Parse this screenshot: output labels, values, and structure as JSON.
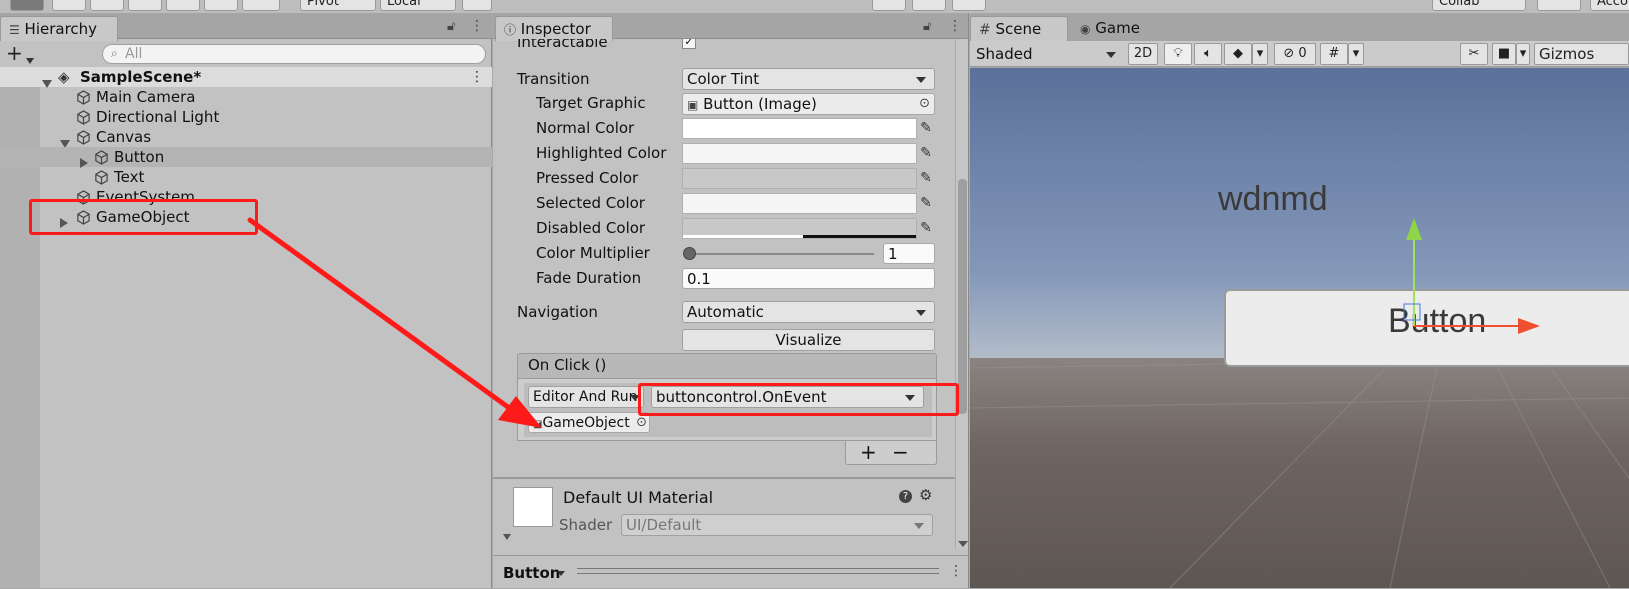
{
  "toolbar": {
    "pivot_label": "Pivot",
    "local_label": "Local",
    "collab_label": "Collab",
    "account_label": "Acco"
  },
  "hierarchy": {
    "tab_label": "Hierarchy",
    "search_placeholder": "All",
    "scene_name": "SampleScene*",
    "items": [
      {
        "label": "Main Camera"
      },
      {
        "label": "Directional Light"
      },
      {
        "label": "Canvas"
      },
      {
        "label": "Button"
      },
      {
        "label": "Text"
      },
      {
        "label": "EventSystem"
      },
      {
        "label": "GameObject"
      }
    ]
  },
  "inspector": {
    "tab_label": "Inspector",
    "interactable_label": "Interactable",
    "transition_label": "Transition",
    "transition_value": "Color Tint",
    "target_graphic_label": "Target Graphic",
    "target_graphic_value": "Button (Image)",
    "normal_color_label": "Normal Color",
    "highlighted_color_label": "Highlighted Color",
    "pressed_color_label": "Pressed Color",
    "selected_color_label": "Selected Color",
    "disabled_color_label": "Disabled Color",
    "color_multiplier_label": "Color Multiplier",
    "color_multiplier_value": "1",
    "fade_duration_label": "Fade Duration",
    "fade_duration_value": "0.1",
    "navigation_label": "Navigation",
    "navigation_value": "Automatic",
    "visualize_label": "Visualize",
    "onclick_header": "On Click ()",
    "runtime_value": "Editor And Run",
    "function_value": "buttoncontrol.OnEvent",
    "object_value": "GameObject",
    "plus_label": "+",
    "minus_label": "−",
    "material_name": "Default UI Material",
    "shader_label": "Shader",
    "shader_value": "UI/Default",
    "footer_label": "Button"
  },
  "scene": {
    "scene_tab_label": "Scene",
    "game_tab_label": "Game",
    "shading_value": "Shaded",
    "two_d_label": "2D",
    "hidden_count": "0",
    "gizmos_label": "Gizmos",
    "world_text": "wdnmd",
    "world_button_text": "Button"
  },
  "colors": {
    "highlight_red": "#ff1a1a",
    "panel_bg": "#c2c2c2",
    "sky_top": "#5b7199",
    "ground": "#6e6560"
  }
}
